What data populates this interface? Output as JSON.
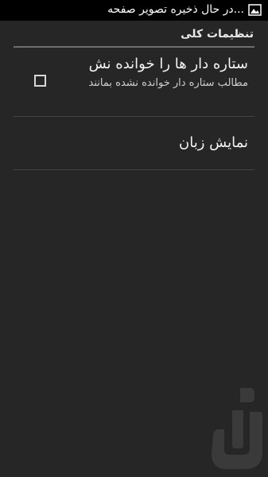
{
  "status_bar": {
    "notification_icon": "image-icon",
    "notification_text": "...در حال ذخیره تصویر صفحه"
  },
  "settings": {
    "section_header": "تنظیمات کلی",
    "items": [
      {
        "title": "ستاره دار ها را خوانده نش",
        "summary": "مطالب ستاره دار خوانده نشده بمانند",
        "checked": false
      },
      {
        "title": "نمایش زبان"
      }
    ]
  },
  "watermark": {
    "icon": "app-logo-icon"
  },
  "colors": {
    "background": "#262626",
    "status_bar": "#000000",
    "divider": "#6e6e6e"
  }
}
